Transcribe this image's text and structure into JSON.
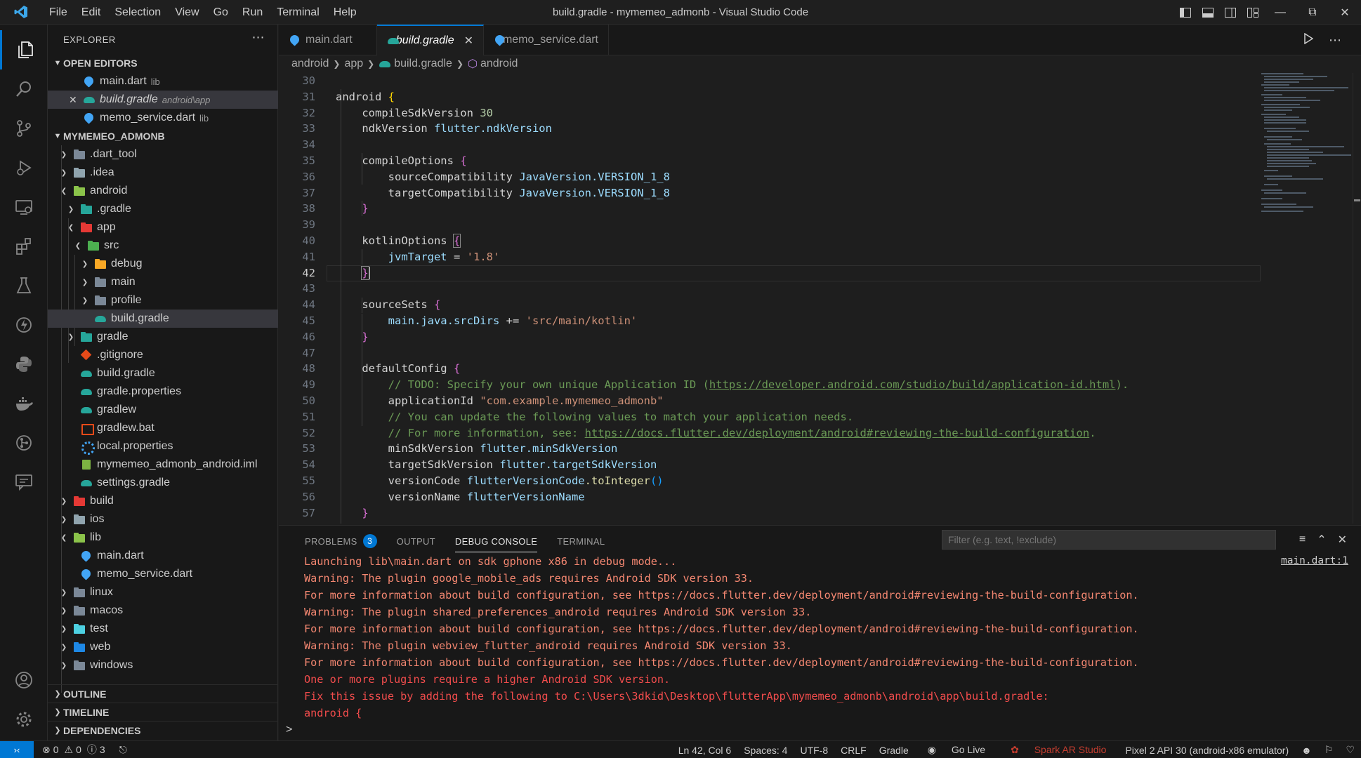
{
  "window": {
    "title": "build.gradle - mymemeo_admonb - Visual Studio Code",
    "menu": [
      "File",
      "Edit",
      "Selection",
      "View",
      "Go",
      "Run",
      "Terminal",
      "Help"
    ]
  },
  "sidebar": {
    "title": "EXPLORER",
    "open_editors_label": "OPEN EDITORS",
    "open_editors": [
      {
        "name": "main.dart",
        "hint": "lib"
      },
      {
        "name": "build.gradle",
        "hint": "android\\app"
      },
      {
        "name": "memo_service.dart",
        "hint": "lib"
      }
    ],
    "project_label": "MYMEMEO_ADMONB",
    "tree": [
      {
        "name": ".dart_tool"
      },
      {
        "name": ".idea"
      },
      {
        "name": "android"
      },
      {
        "name": ".gradle"
      },
      {
        "name": "app"
      },
      {
        "name": "src"
      },
      {
        "name": "debug"
      },
      {
        "name": "main"
      },
      {
        "name": "profile"
      },
      {
        "name": "build.gradle"
      },
      {
        "name": "gradle"
      },
      {
        "name": ".gitignore"
      },
      {
        "name": "build.gradle"
      },
      {
        "name": "gradle.properties"
      },
      {
        "name": "gradlew"
      },
      {
        "name": "gradlew.bat"
      },
      {
        "name": "local.properties"
      },
      {
        "name": "mymemeo_admonb_android.iml"
      },
      {
        "name": "settings.gradle"
      },
      {
        "name": "build"
      },
      {
        "name": "ios"
      },
      {
        "name": "lib"
      },
      {
        "name": "main.dart"
      },
      {
        "name": "memo_service.dart"
      },
      {
        "name": "linux"
      },
      {
        "name": "macos"
      },
      {
        "name": "test"
      },
      {
        "name": "web"
      },
      {
        "name": "windows"
      }
    ],
    "outline_label": "OUTLINE",
    "timeline_label": "TIMELINE",
    "dependencies_label": "DEPENDENCIES"
  },
  "tabs": [
    {
      "label": "main.dart"
    },
    {
      "label": "build.gradle"
    },
    {
      "label": "memo_service.dart"
    }
  ],
  "breadcrumb": [
    "android",
    "app",
    "build.gradle",
    "android"
  ],
  "editor": {
    "current_line": 42,
    "lines": [
      {
        "n": "30"
      },
      {
        "n": "31"
      },
      {
        "n": "32"
      },
      {
        "n": "33"
      },
      {
        "n": "34"
      },
      {
        "n": "35"
      },
      {
        "n": "36"
      },
      {
        "n": "37"
      },
      {
        "n": "38"
      },
      {
        "n": "39"
      },
      {
        "n": "40"
      },
      {
        "n": "41"
      },
      {
        "n": "42"
      },
      {
        "n": "43"
      },
      {
        "n": "44"
      },
      {
        "n": "45"
      },
      {
        "n": "46"
      },
      {
        "n": "47"
      },
      {
        "n": "48"
      },
      {
        "n": "49"
      },
      {
        "n": "50"
      },
      {
        "n": "51"
      },
      {
        "n": "52"
      },
      {
        "n": "53"
      },
      {
        "n": "54"
      },
      {
        "n": "55"
      },
      {
        "n": "56"
      },
      {
        "n": "57"
      }
    ],
    "code": {
      "android": "android",
      "compileSdkVersion": "compileSdkVersion",
      "v30": "30",
      "ndkVersion": "ndkVersion",
      "flutter_ndkVersion": "flutter.ndkVersion",
      "compileOptions": "compileOptions",
      "sourceCompatibility": "sourceCompatibility",
      "targetCompatibility": "targetCompatibility",
      "JavaVersion": "JavaVersion",
      "VERSION_1_8": ".VERSION_1_8",
      "kotlinOptions": "kotlinOptions",
      "jvmTarget": "jvmTarget",
      "eq": " = ",
      "s18": "'1.8'",
      "sourceSets": "sourceSets",
      "main_java_srcDirs": "main.java.srcDirs",
      "pluseq": " += ",
      "s_kotlin": "'src/main/kotlin'",
      "defaultConfig": "defaultConfig",
      "c49a": "// TODO: Specify your own unique Application ID (",
      "c49url": "https://developer.android.com/studio/build/application-id.html",
      "c49b": ").",
      "applicationId": "applicationId",
      "s_appid": "\"com.example.mymemeo_admonb\"",
      "c51": "// You can update the following values to match your application needs.",
      "c52a": "// For more information, see: ",
      "c52url": "https://docs.flutter.dev/deployment/android#reviewing-the-build-configuration",
      "c52b": ".",
      "minSdkVersion": "minSdkVersion",
      "flutter_minSdkVersion": "flutter.minSdkVersion",
      "targetSdkVersion": "targetSdkVersion",
      "flutter_targetSdkVersion": "flutter.targetSdkVersion",
      "versionCode": "versionCode",
      "flutterVersionCode": "flutterVersionCode",
      "toInteger": ".toInteger",
      "versionName": "versionName",
      "flutterVersionName": "flutterVersionName"
    }
  },
  "panel": {
    "tabs": [
      {
        "label": "PROBLEMS",
        "badge": "3"
      },
      {
        "label": "OUTPUT"
      },
      {
        "label": "DEBUG CONSOLE"
      },
      {
        "label": "TERMINAL"
      }
    ],
    "filter_placeholder": "Filter (e.g. text, !exclude)",
    "link": "main.dart:1",
    "prompt": ">",
    "console": [
      {
        "text": "Launching lib\\main.dart on sdk gphone x86 in debug mode..."
      },
      {
        "text": "Warning: The plugin google_mobile_ads requires Android SDK version 33."
      },
      {
        "text": "For more information about build configuration, see https://docs.flutter.dev/deployment/android#reviewing-the-build-configuration."
      },
      {
        "text": "Warning: The plugin shared_preferences_android requires Android SDK version 33."
      },
      {
        "text": "For more information about build configuration, see https://docs.flutter.dev/deployment/android#reviewing-the-build-configuration."
      },
      {
        "text": "Warning: The plugin webview_flutter_android requires Android SDK version 33."
      },
      {
        "text": "For more information about build configuration, see https://docs.flutter.dev/deployment/android#reviewing-the-build-configuration."
      },
      {
        "text": "One or more plugins require a higher Android SDK version."
      },
      {
        "text": "Fix this issue by adding the following to C:\\Users\\3dkid\\Desktop\\flutterApp\\mymemeo_admonb\\android\\app\\build.gradle:"
      },
      {
        "text": "android {"
      }
    ]
  },
  "status": {
    "errors": "0",
    "warnings": "0",
    "infos": "3",
    "position": "Ln 42, Col 6",
    "spaces": "Spaces: 4",
    "encoding": "UTF-8",
    "eol": "CRLF",
    "language": "Gradle",
    "golive": "Go Live",
    "sparkar": "Spark AR Studio",
    "device": "Pixel 2 API 30 (android-x86 emulator)"
  },
  "colors": {
    "accent": "#0078d4",
    "error_text": "#f14c4c",
    "console_text": "#f48771"
  }
}
